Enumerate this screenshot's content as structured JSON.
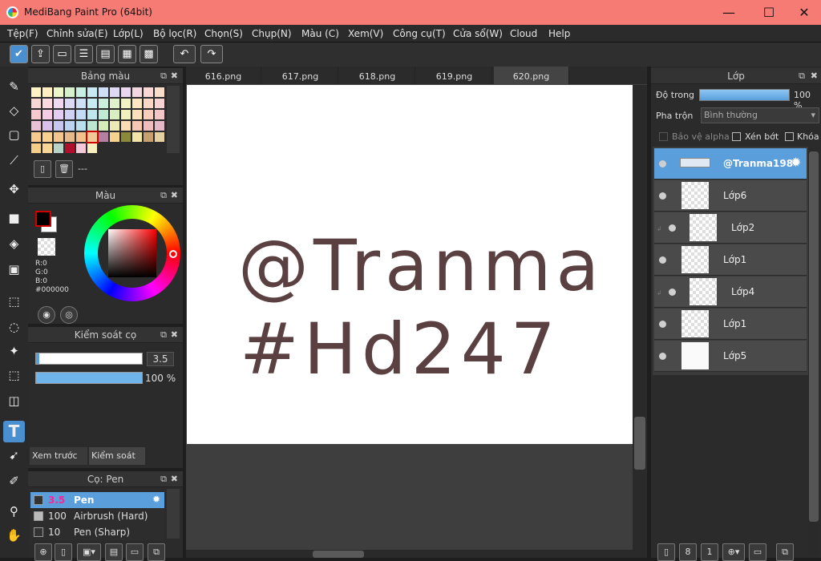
{
  "app": {
    "title": "MediBang Paint Pro (64bit)"
  },
  "window": {
    "minimize": "—",
    "maximize": "☐",
    "close": "✕"
  },
  "menu": [
    "Tệp(F)",
    "Chỉnh sửa(E)",
    "Lớp(L)",
    "Bộ lọc(R)",
    "Chọn(S)",
    "Chụp(N)",
    "Màu (C)",
    "Xem(V)",
    "Công cụ(T)",
    "Cửa sổ(W)",
    "Cloud",
    "Help"
  ],
  "palette": {
    "title": "Bảng màu",
    "name": "---"
  },
  "color": {
    "title": "Màu",
    "r": "R:0",
    "g": "G:0",
    "b": "B:0",
    "hex": "#000000"
  },
  "brushcontrol": {
    "title": "Kiểm soát cọ",
    "size": "3.5",
    "opacity": "100 %",
    "size_fill": 0.03,
    "opacity_fill": 1.0
  },
  "subtabs": {
    "preview": "Xem trước cọ",
    "control": "Kiểm soát cọ"
  },
  "brushes": {
    "title": "Cọ: Pen",
    "items": [
      {
        "size": "3.5",
        "name": "Pen"
      },
      {
        "size": "100",
        "name": "Airbrush (Hard)"
      },
      {
        "size": "10",
        "name": "Pen (Sharp)"
      }
    ]
  },
  "tabs": [
    "616.png",
    "617.png",
    "618.png",
    "619.png",
    "620.png"
  ],
  "canvas": {
    "line1": "@Tranma l",
    "line2": "#Hd247"
  },
  "layers": {
    "title": "Lớp",
    "opacity_label": "Độ trong",
    "opacity_value": "100 %",
    "blend_label": "Pha trộn",
    "blend_value": "Bình thường",
    "protect_alpha": "Bảo vệ alpha",
    "clip": "Xén bớt",
    "lock": "Khóa",
    "items": [
      {
        "name": "@Tranma198"
      },
      {
        "name": "Lớp6"
      },
      {
        "name": "Lớp2"
      },
      {
        "name": "Lớp1"
      },
      {
        "name": "Lớp4"
      },
      {
        "name": "Lớp1"
      },
      {
        "name": "Lớp5"
      }
    ]
  },
  "colors": {
    "accent": "#5a9fdc",
    "titlebar": "#f77b75",
    "text_on_canvas": "#5a4040"
  }
}
